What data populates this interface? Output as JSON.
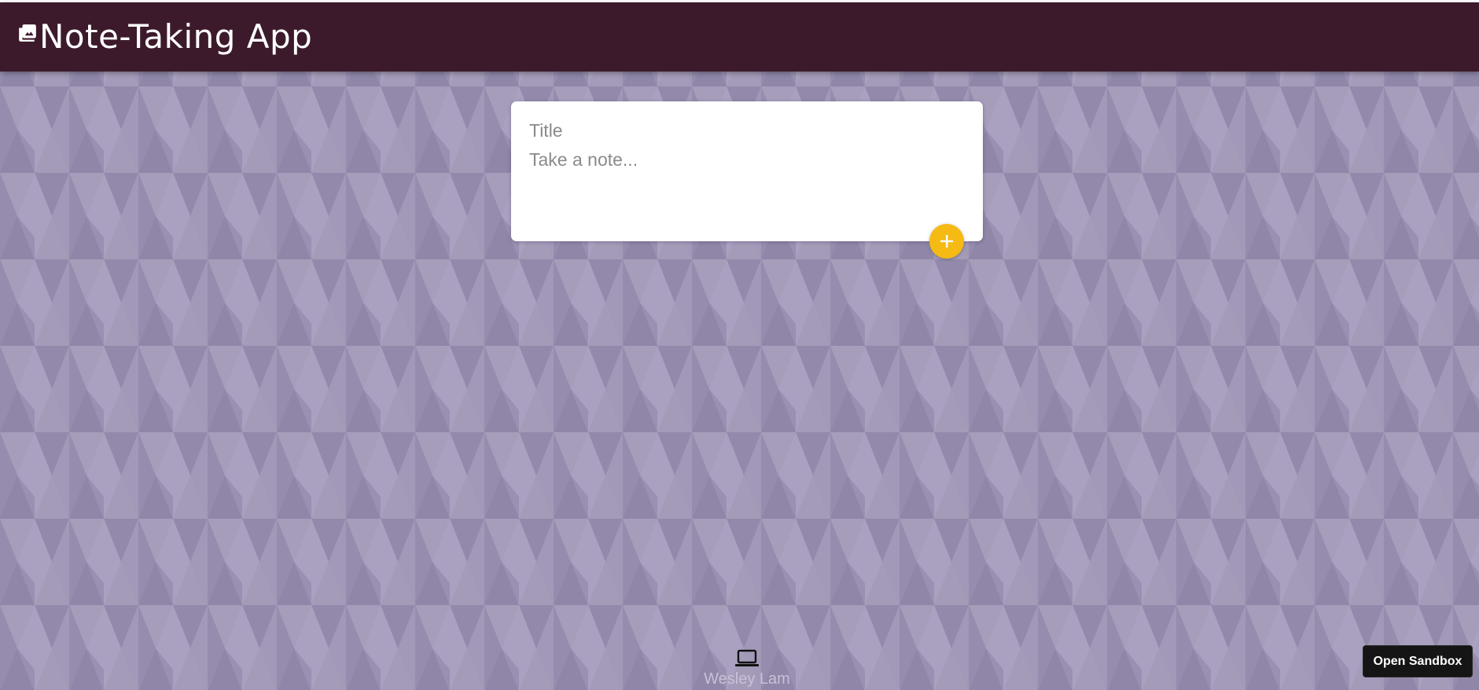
{
  "app": {
    "title": "Note-Taking App",
    "logo_icon": "image-library-icon"
  },
  "note_form": {
    "title_value": "",
    "title_placeholder": "Title",
    "content_value": "",
    "content_placeholder": "Take a note...",
    "add_button_icon": "plus-icon"
  },
  "footer": {
    "icon": "laptop-icon",
    "name": "Wesley Lam"
  },
  "sandbox": {
    "label": "Open Sandbox"
  },
  "colors": {
    "header": "#3c1a2b",
    "background": "#9e94b4",
    "accent": "#f5ba13"
  }
}
